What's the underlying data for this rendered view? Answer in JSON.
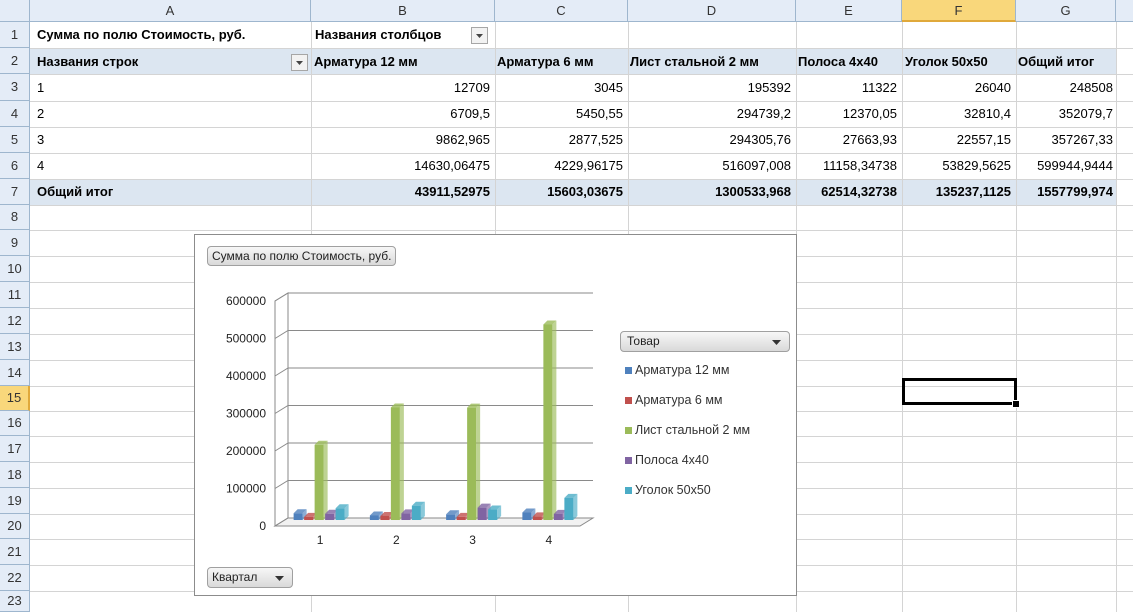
{
  "columns": [
    "A",
    "B",
    "C",
    "D",
    "E",
    "F",
    "G"
  ],
  "rows": [
    "1",
    "2",
    "3",
    "4",
    "5",
    "6",
    "7",
    "8",
    "9",
    "10",
    "11",
    "12",
    "13",
    "14",
    "15",
    "16",
    "17",
    "18",
    "19",
    "20",
    "21",
    "22",
    "23"
  ],
  "selected": {
    "column": "F",
    "row": "15"
  },
  "pivot": {
    "value_field": "Сумма по полю Стоимость, руб.",
    "column_labels_caption": "Названия столбцов",
    "row_labels_caption": "Названия строк",
    "headers": [
      "Арматура 12 мм",
      "Арматура 6 мм",
      "Лист стальной 2 мм",
      "Полоса 4х40",
      "Уголок 50х50",
      "Общий итог"
    ],
    "data_rows": [
      {
        "label": "1",
        "values": [
          "12709",
          "3045",
          "195392",
          "11322",
          "26040",
          "248508"
        ]
      },
      {
        "label": "2",
        "values": [
          "6709,5",
          "5450,55",
          "294739,2",
          "12370,05",
          "32810,4",
          "352079,7"
        ]
      },
      {
        "label": "3",
        "values": [
          "9862,965",
          "2877,525",
          "294305,76",
          "27663,93",
          "22557,15",
          "357267,33"
        ]
      },
      {
        "label": "4",
        "values": [
          "14630,06475",
          "4229,96175",
          "516097,008",
          "11158,34738",
          "53829,5625",
          "599944,9444"
        ]
      }
    ],
    "total_row": {
      "label": "Общий итог",
      "values": [
        "43911,52975",
        "15603,03675",
        "1300533,968",
        "62514,32738",
        "135237,1125",
        "1557799,974"
      ]
    }
  },
  "chart": {
    "value_button": "Сумма по полю Стоимость, руб.",
    "legend_button": "Товар",
    "axis_button": "Квартал"
  },
  "chart_data": {
    "type": "bar",
    "categories": [
      "1",
      "2",
      "3",
      "4"
    ],
    "series": [
      {
        "name": "Арматура 12 мм",
        "values": [
          12709,
          6709.5,
          9862.965,
          14630.06475
        ],
        "color": "#4f81bd"
      },
      {
        "name": "Арматура 6 мм",
        "values": [
          3045,
          5450.55,
          2877.525,
          4229.96175
        ],
        "color": "#c0504d"
      },
      {
        "name": "Лист стальной 2 мм",
        "values": [
          195392,
          294739.2,
          294305.76,
          516097.008
        ],
        "color": "#9bbb59"
      },
      {
        "name": "Полоса 4х40",
        "values": [
          11322,
          12370.05,
          27663.93,
          11158.34738
        ],
        "color": "#8064a2"
      },
      {
        "name": "Уголок 50х50",
        "values": [
          26040,
          32810.4,
          22557.15,
          53829.5625
        ],
        "color": "#4bacc6"
      }
    ],
    "yticks": [
      "0",
      "100000",
      "200000",
      "300000",
      "400000",
      "500000",
      "600000"
    ],
    "ylim": [
      0,
      600000
    ],
    "grid": true,
    "legend": "right"
  }
}
